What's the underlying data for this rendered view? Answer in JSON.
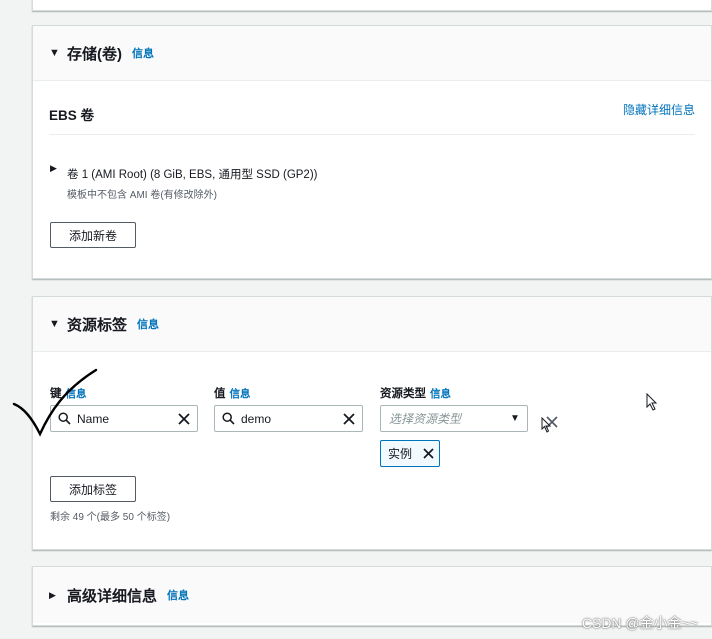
{
  "storage": {
    "title": "存储(卷)",
    "info": "信息",
    "ebs_heading": "EBS 卷",
    "hide_details": "隐藏详细信息",
    "volume_label": "卷 1 (AMI Root) (8 GiB, EBS, 通用型 SSD (GP2))",
    "volume_note": "模板中不包含 AMI 卷(有修改除外)",
    "add_volume": "添加新卷"
  },
  "tags": {
    "title": "资源标签",
    "info": "信息",
    "key_label": "键",
    "key_info": "信息",
    "key_value": "Name",
    "value_label": "值",
    "value_info": "信息",
    "value_value": "demo",
    "resource_type_label": "资源类型",
    "resource_type_info": "信息",
    "resource_type_placeholder": "选择资源类型",
    "token": "实例",
    "add_tag": "添加标签",
    "remaining": "剩余 49 个(最多 50 个标签)"
  },
  "advanced": {
    "title": "高级详细信息",
    "info": "信息"
  },
  "watermark": "CSDN @金小金~~",
  "colors": {
    "link": "#0073bb",
    "token_bg": "#f1faff",
    "token_border": "#0073bb"
  }
}
